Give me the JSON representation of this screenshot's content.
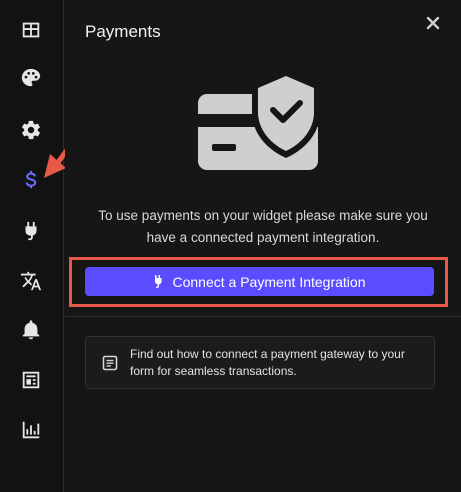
{
  "sidebar": {
    "items": [
      {
        "name": "layout",
        "icon": "layout-grid-icon"
      },
      {
        "name": "design",
        "icon": "palette-icon"
      },
      {
        "name": "settings",
        "icon": "gear-icon"
      },
      {
        "name": "payments",
        "icon": "dollar-icon",
        "active": true
      },
      {
        "name": "integrations",
        "icon": "plug-icon"
      },
      {
        "name": "translations",
        "icon": "translate-icon"
      },
      {
        "name": "notifications",
        "icon": "bell-icon"
      },
      {
        "name": "submissions",
        "icon": "newspaper-icon"
      },
      {
        "name": "analytics",
        "icon": "bar-chart-icon"
      }
    ],
    "accent_color": "#6c6cff"
  },
  "panel": {
    "title": "Payments",
    "message": "To use payments on your widget please make sure you have a connected payment integration.",
    "connect_button": {
      "label": "Connect a Payment Integration",
      "icon": "plug-icon",
      "color": "#5b4dff"
    },
    "info": {
      "icon": "document-icon",
      "text": "Find out how to connect a payment gateway to your form for seamless transactions."
    }
  },
  "annotation": {
    "color": "#e8594a"
  }
}
